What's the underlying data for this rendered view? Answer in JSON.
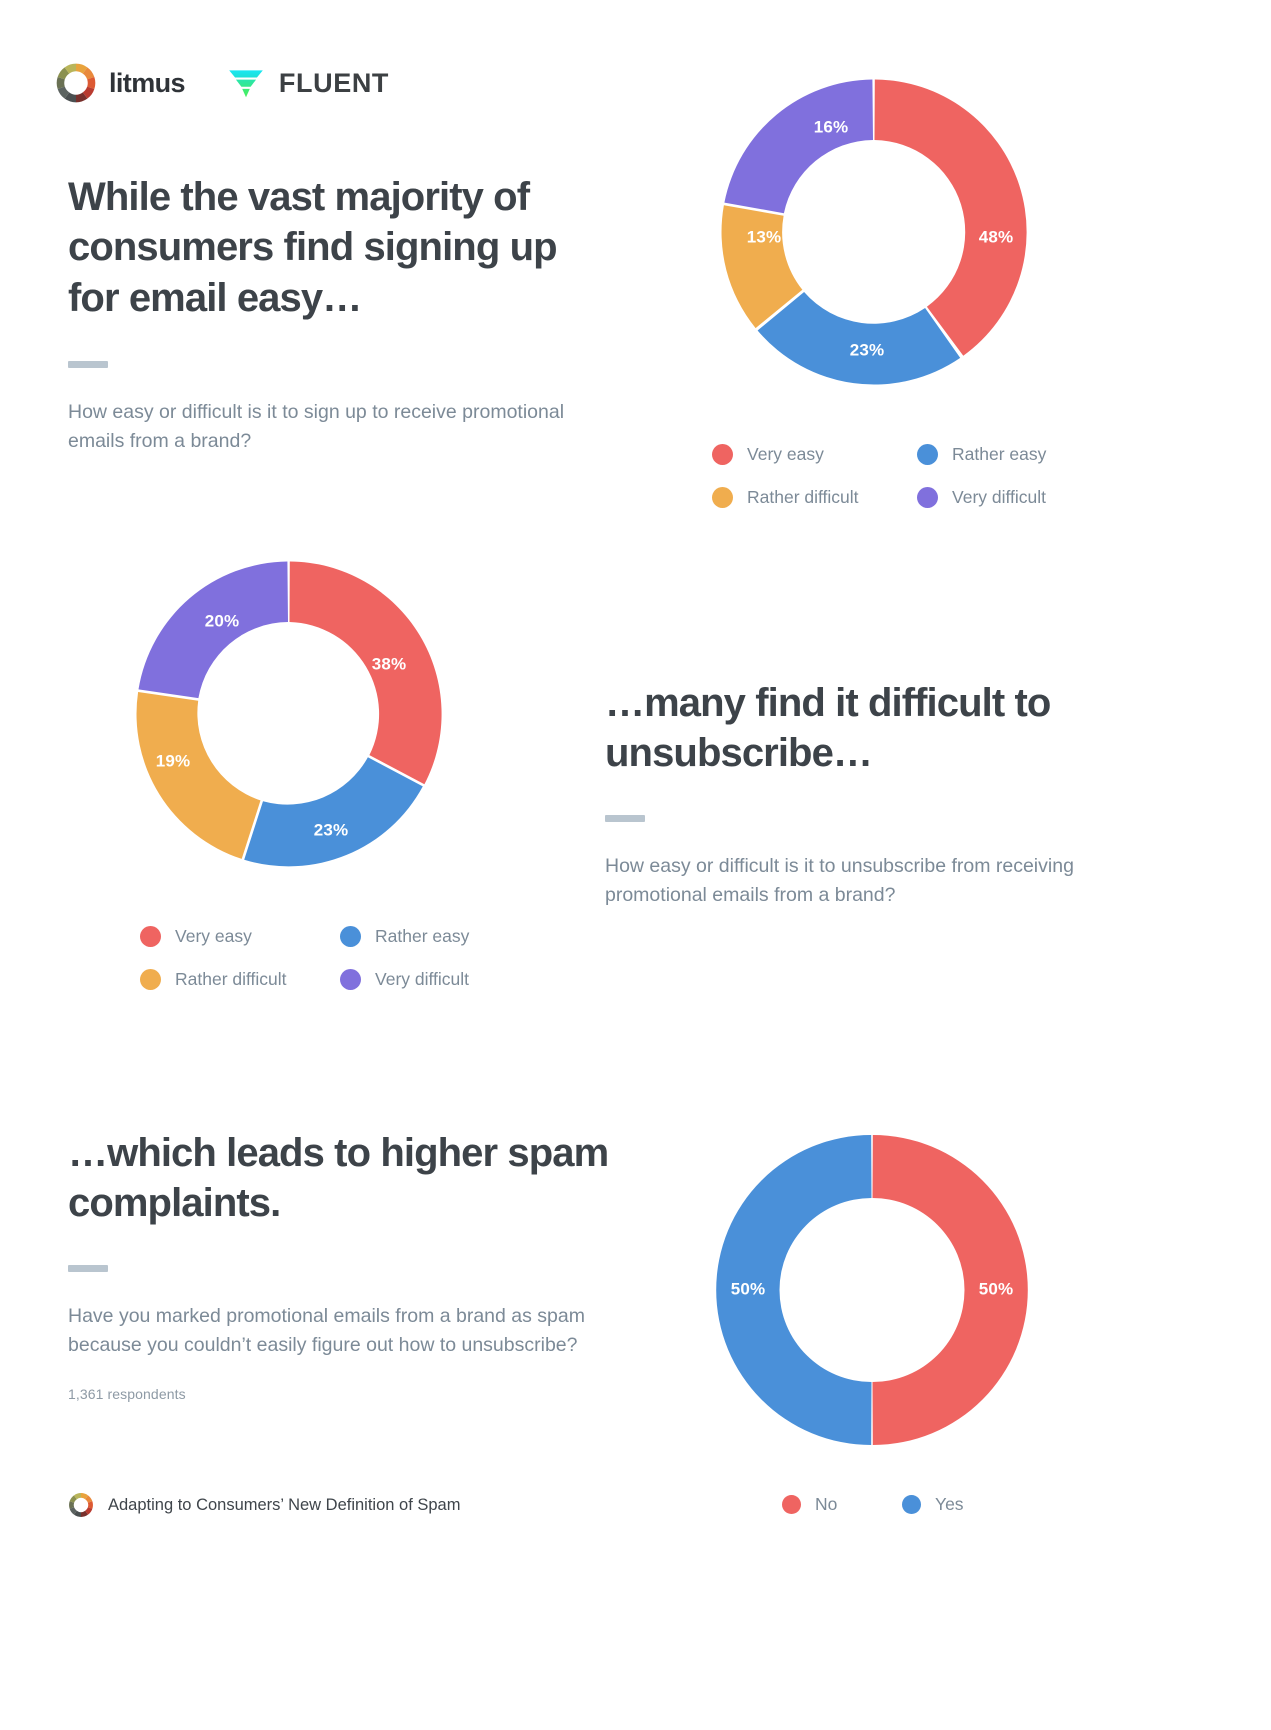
{
  "brand": {
    "litmus_name": "litmus",
    "litmus_icon": "litmus-color-wheel-icon",
    "fluent_name": "FLUENT",
    "fluent_icon": "fluent-funnel-icon"
  },
  "colors": {
    "very_easy": "#ef6461",
    "rather_easy": "#4a90d9",
    "rather_difficult": "#f0ad4e",
    "very_difficult": "#8070dd",
    "no": "#ef6461",
    "yes": "#4a90d9",
    "headline": "#3d4349",
    "body": "#7c8a97",
    "rule": "#b9c5cf"
  },
  "sections": [
    {
      "id": "signup",
      "headline": "While the vast majority of consumers find signing up for email easy…",
      "question": "How easy or difficult is it to sign up to receive promotional emails from a brand?"
    },
    {
      "id": "unsubscribe",
      "headline": "…many find it difficult to unsubscribe…",
      "question": "How easy or difficult is it to unsubscribe from receiving promotional emails from a brand?"
    },
    {
      "id": "spam",
      "headline": "…which leads to higher spam complaints.",
      "question": "Have you marked promotional emails from a brand as spam because you couldn’t easily figure out how to unsubscribe?",
      "respondents": "1,361  respondents"
    }
  ],
  "footer": {
    "icon": "litmus-color-wheel-icon",
    "text": "Adapting to Consumers’ New Definition of Spam"
  },
  "chart_data": [
    {
      "type": "pie",
      "id": "signup-ease-donut",
      "title": "How easy or difficult is it to sign up to receive promotional emails from a brand?",
      "categories": [
        "Very easy",
        "Rather easy",
        "Rather difficult",
        "Very difficult"
      ],
      "values": [
        48,
        23,
        13,
        16
      ],
      "labels": [
        "48%",
        "23%",
        "13%",
        "16%"
      ],
      "colors": [
        "#ef6461",
        "#4a90d9",
        "#f0ad4e",
        "#8070dd"
      ],
      "legend_position": "bottom",
      "donut": true
    },
    {
      "type": "pie",
      "id": "unsubscribe-ease-donut",
      "title": "How easy or difficult is it to unsubscribe from receiving promotional emails from a brand?",
      "categories": [
        "Very easy",
        "Rather easy",
        "Rather difficult",
        "Very difficult"
      ],
      "values": [
        38,
        23,
        19,
        20
      ],
      "labels": [
        "38%",
        "23%",
        "19%",
        "20%"
      ],
      "colors": [
        "#ef6461",
        "#4a90d9",
        "#f0ad4e",
        "#8070dd"
      ],
      "legend_position": "bottom",
      "donut": true
    },
    {
      "type": "pie",
      "id": "spam-marked-donut",
      "title": "Have you marked promotional emails from a brand as spam because you couldn’t easily figure out how to unsubscribe?",
      "categories": [
        "No",
        "Yes"
      ],
      "values": [
        50,
        50
      ],
      "labels": [
        "50%",
        "50%"
      ],
      "colors": [
        "#ef6461",
        "#4a90d9"
      ],
      "legend_position": "bottom",
      "donut": true
    }
  ]
}
